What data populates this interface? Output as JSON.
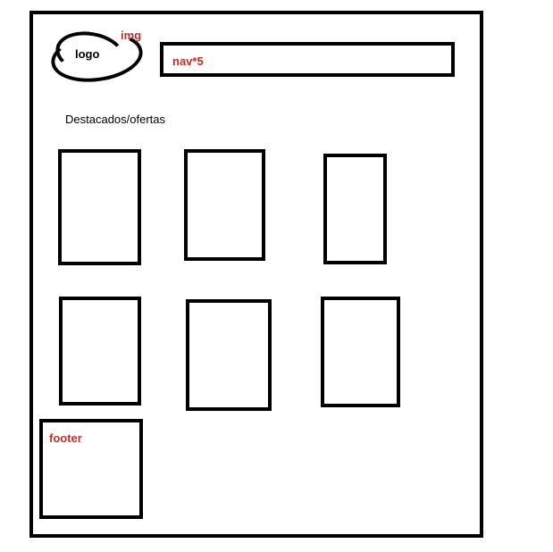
{
  "logo": {
    "label": "logo",
    "img_note": "img"
  },
  "nav": {
    "label": "nav*5"
  },
  "section": {
    "title": "Destacados/ofertas",
    "cards": [
      {
        "row": 1,
        "col": 1
      },
      {
        "row": 1,
        "col": 2
      },
      {
        "row": 1,
        "col": 3
      },
      {
        "row": 2,
        "col": 1
      },
      {
        "row": 2,
        "col": 2
      },
      {
        "row": 2,
        "col": 3
      }
    ]
  },
  "footer": {
    "label": "footer"
  },
  "colors": {
    "outline": "#000000",
    "annotation": "#c0302a",
    "background": "#ffffff"
  }
}
